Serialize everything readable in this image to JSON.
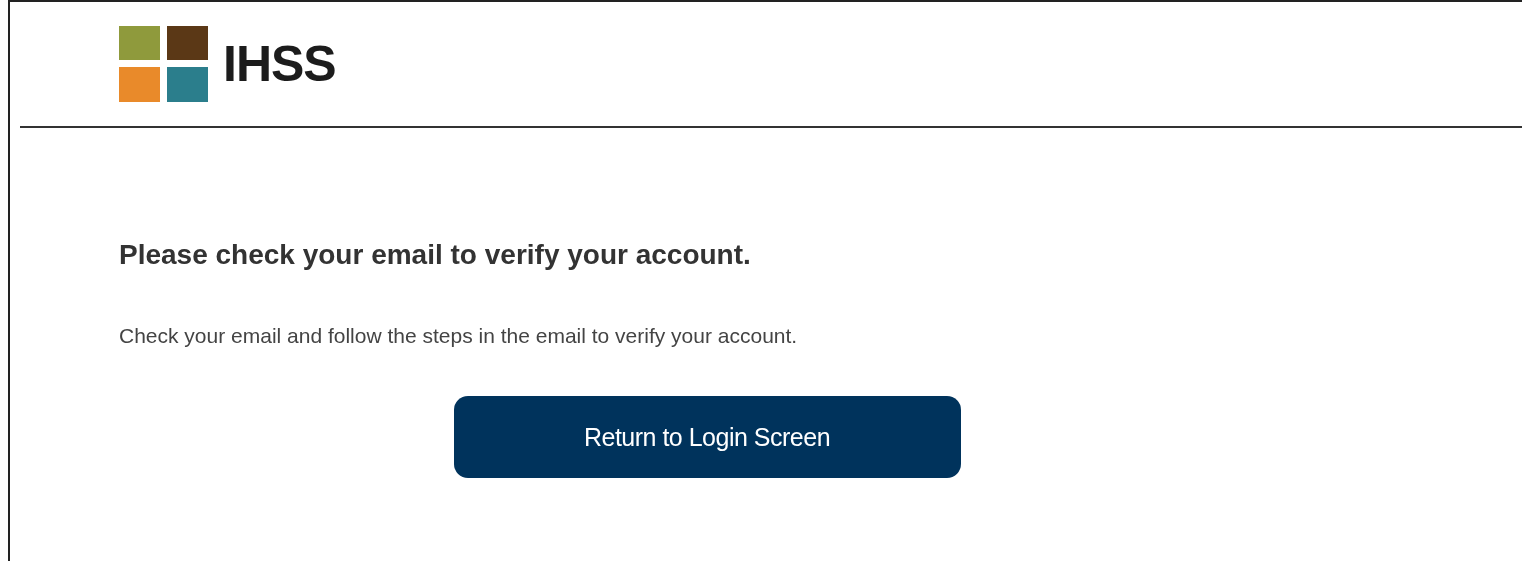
{
  "header": {
    "logo_text": "IHSS"
  },
  "content": {
    "heading": "Please check your email to verify your account.",
    "message": "Check your email and follow the steps in the email to verify your account."
  },
  "buttons": [
    {
      "label": "Return to Login Screen"
    }
  ]
}
